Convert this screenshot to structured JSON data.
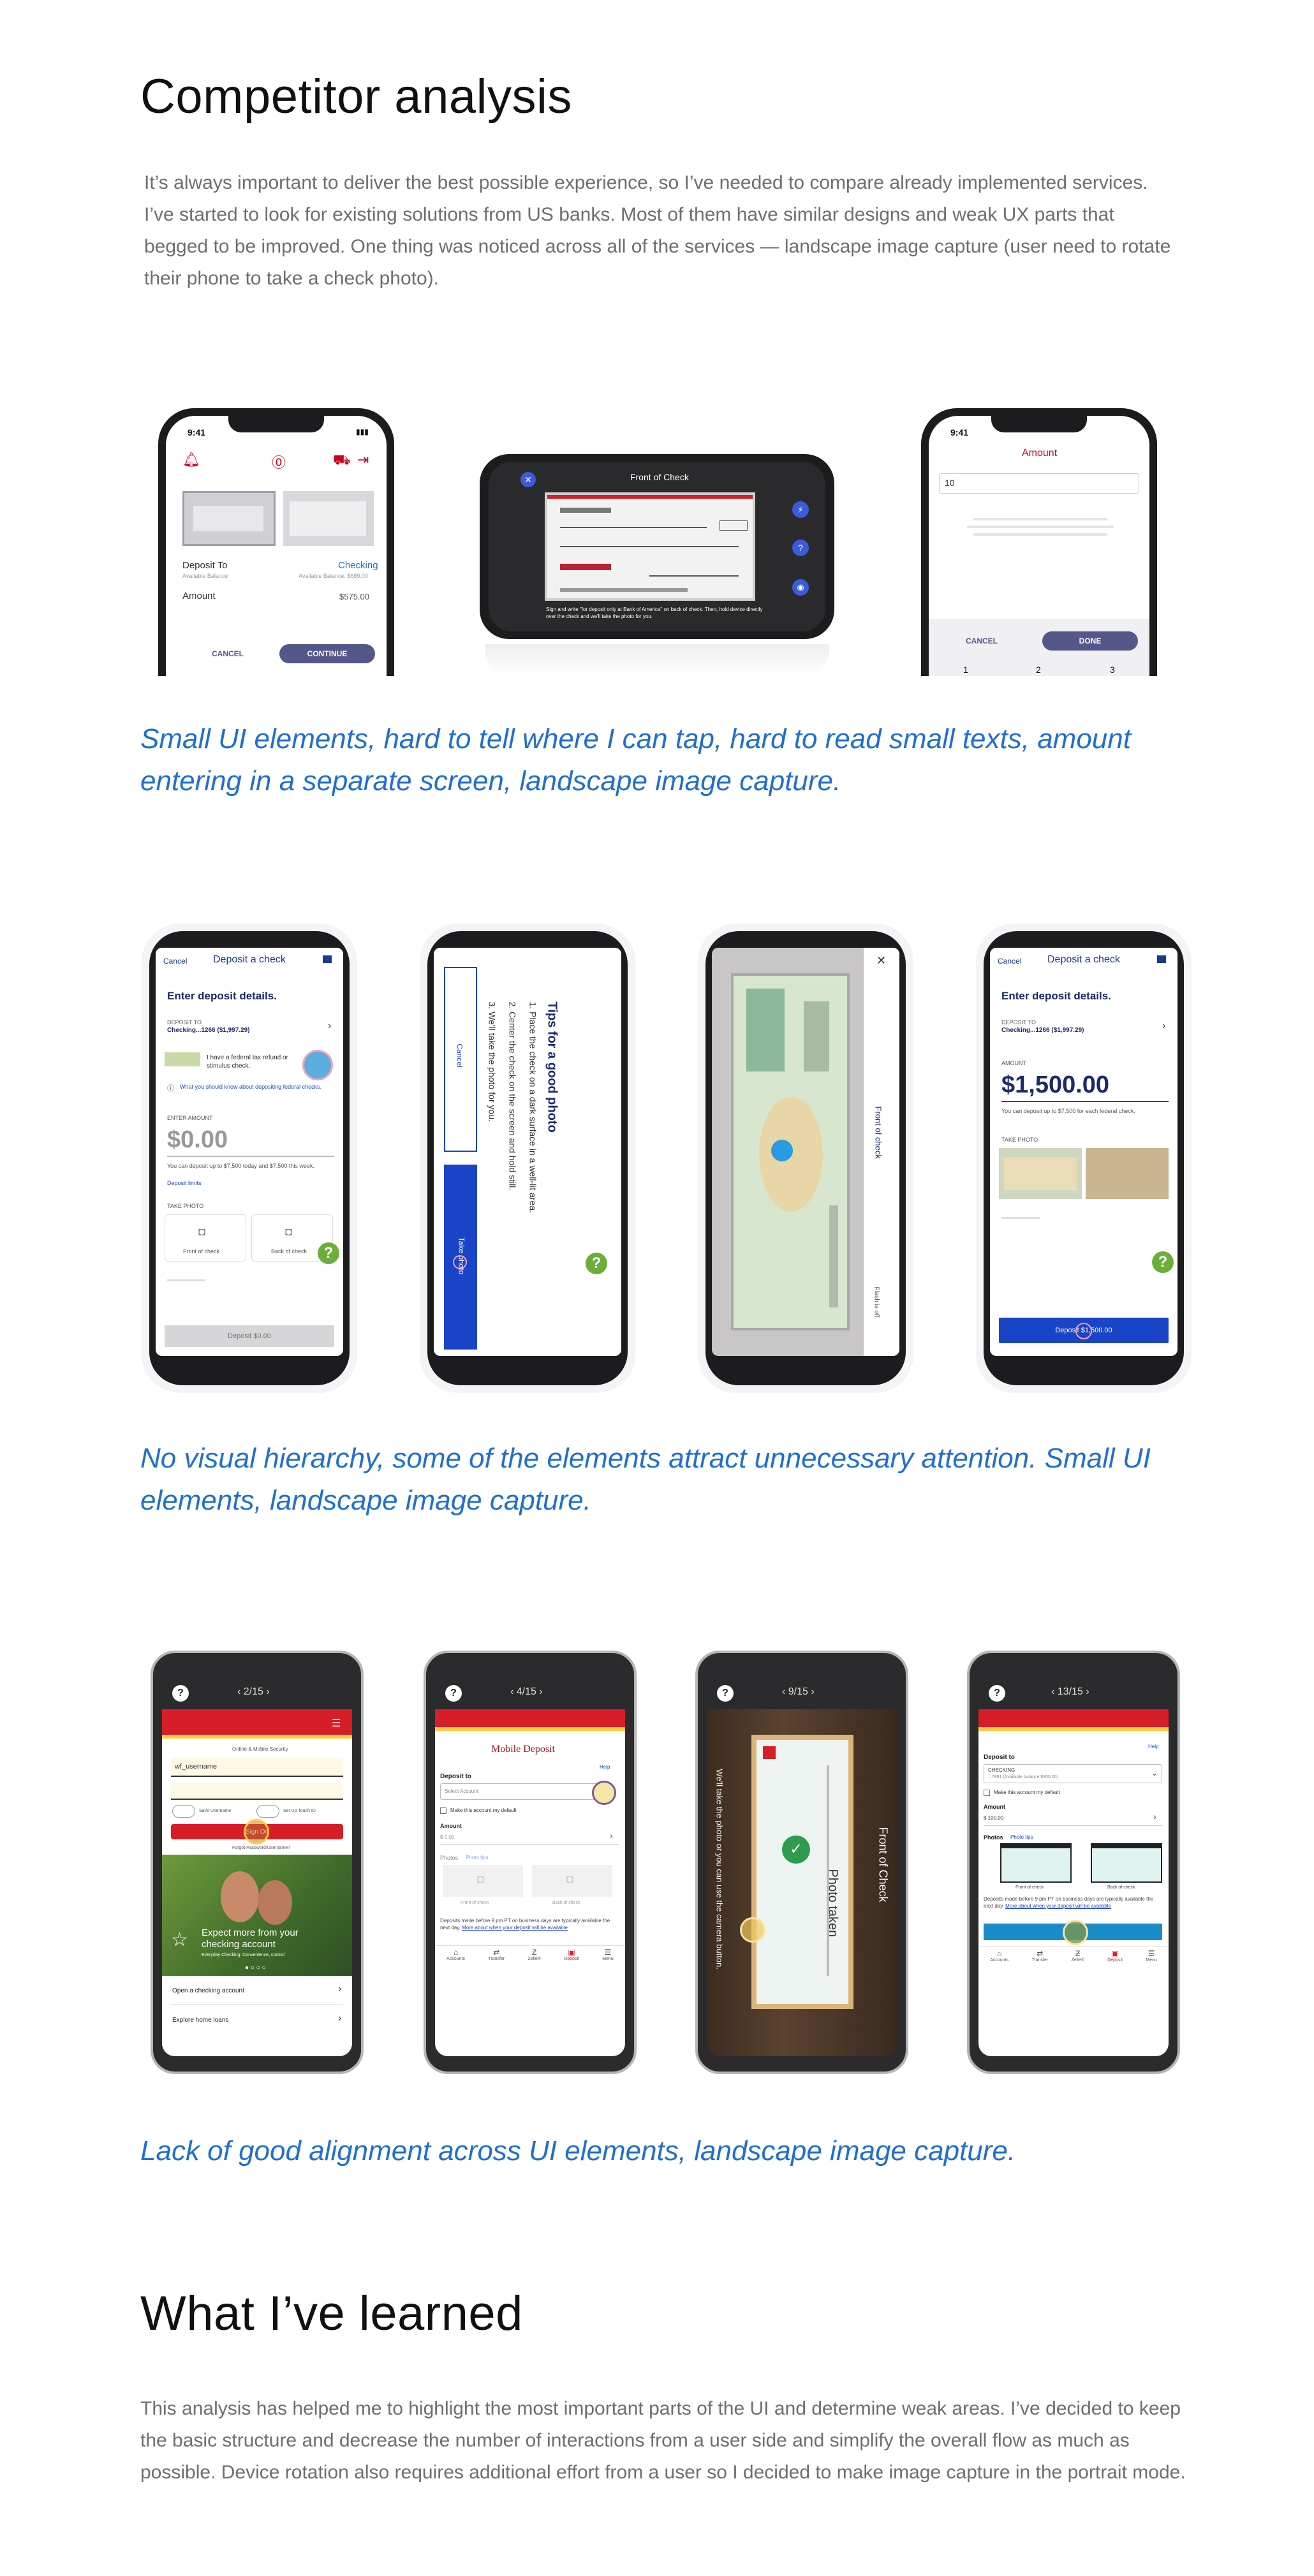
{
  "section1": {
    "title": "Competitor analysis",
    "intro": "It’s always important to deliver the best possible experience, so I’ve needed to compare already implemented services. I’ve started to look for existing solutions from US banks. Most of them have similar designs and weak UX parts that begged to be improved. One thing was noticed across all of the services — landscape image capture (user need to rotate their phone to take a check photo)."
  },
  "row1": {
    "caption": "Small UI elements, hard to tell where I can tap, hard to read small texts, amount entering in a separate screen, landscape image capture.",
    "phone1": {
      "time": "9:41",
      "deposit_to": "Deposit To",
      "available_balance": "Available Balance",
      "account": "Checking",
      "account_balance": "Available Balance: $689.00",
      "amount_label": "Amount",
      "amount_value": "$575.00",
      "cancel": "CANCEL",
      "continue": "CONTINUE"
    },
    "phone2": {
      "title": "Front of Check",
      "hint": "Sign and write \"for deposit only at Bank of America\" on back of check. Then, hold device directly over the check and we'll take the photo for you."
    },
    "phone3": {
      "time": "9:41",
      "title": "Amount",
      "value": "10",
      "cancel": "CANCEL",
      "done": "DONE",
      "keys": [
        "1",
        "2",
        "3"
      ]
    }
  },
  "row2": {
    "caption": "No visual hierarchy, some of the elements attract unnecessary attention. Small UI elements, landscape image capture.",
    "phone1": {
      "cancel": "Cancel",
      "title": "Deposit a check",
      "heading": "Enter deposit details.",
      "deposit_to": "DEPOSIT TO",
      "account": "Checking...1266 ($1,997.29)",
      "refund_text": "I have a federal tax refund or stimulus check.",
      "info_text": "What you should know about depositing federal checks.",
      "enter_amount": "ENTER AMOUNT",
      "amount": "$0.00",
      "limit_text": "You can deposit up to $7,500 today and $7,500 this week.",
      "deposit_limits": "Deposit limits",
      "take_photo": "TAKE PHOTO",
      "front": "Front of check",
      "back": "Back of check",
      "button": "Deposit $0.00"
    },
    "phone2": {
      "title": "Tips for a good photo",
      "tip1": "1. Place the check on a dark surface in a well-lit area.",
      "tip2": "2. Center the check on the screen and hold still.",
      "tip3": "3. We'll take the photo for you.",
      "cancel": "Cancel",
      "take_photo": "Take photo"
    },
    "phone3": {
      "side_label": "Front of check",
      "flash": "Flash is off"
    },
    "phone4": {
      "cancel": "Cancel",
      "title": "Deposit a check",
      "heading": "Enter deposit details.",
      "deposit_to": "DEPOSIT TO",
      "account": "Checking...1266 ($1,997.29)",
      "amount_label": "AMOUNT",
      "amount": "$1,500.00",
      "limit_text": "You can deposit up to $7,500 for each federal check.",
      "take_photo": "TAKE PHOTO",
      "button": "Deposit $1,500.00"
    }
  },
  "row3": {
    "caption": "Lack of good alignment across UI elements, landscape image capture.",
    "phone1": {
      "pager": "‹  2/15  ›",
      "security": "Online & Mobile Security",
      "username": "wf_username",
      "save_username": "Save Username",
      "touch_id": "Set Up Touch ID",
      "sign_on": "Sign On",
      "forgot": "Forgot Password/Username?",
      "promo": "Expect more from your checking account",
      "promo_sub": "Everyday Checking. Convenience, control",
      "link1": "Open a checking account",
      "link2": "Explore home loans"
    },
    "phone2": {
      "pager": "‹  4/15  ›",
      "title": "Mobile Deposit",
      "help": "Help",
      "deposit_to": "Deposit to",
      "select_account": "Select Account",
      "default_text": "Make this account my default",
      "amount_label": "Amount",
      "amount": "$ 0.00",
      "photos": "Photos",
      "photo_tips": "Photo tips",
      "front": "Front of check",
      "back": "Back of check",
      "note": "Deposits made before 9 pm PT on business days are typically available the next day.",
      "note_link": "More about when your deposit will be available",
      "nav": [
        "Accounts",
        "Transfer",
        "Zelle®",
        "Deposit",
        "Menu"
      ]
    },
    "phone3": {
      "pager": "‹  9/15  ›",
      "side_left": "We'll take the photo or you can use the camera button.",
      "side_right": "Front of Check",
      "taken": "Photo taken"
    },
    "phone4": {
      "pager": "‹  13/15  ›",
      "help": "Help",
      "deposit_to": "Deposit to",
      "account": "CHECKING",
      "account_sub": "...7891 (Available balance $300.00)",
      "default_text": "Make this account my default",
      "amount_label": "Amount",
      "amount": "$ 100.00",
      "photos": "Photos",
      "photo_tips": "Photo tips",
      "front": "Front of check",
      "back": "Back of check",
      "note": "Deposits made before 9 pm PT on business days are typically available the next day.",
      "note_link": "More about when your deposit will be available",
      "nav": [
        "Accounts",
        "Transfer",
        "Zelle®",
        "Deposit",
        "Menu"
      ]
    }
  },
  "section2": {
    "title": "What I’ve learned",
    "body": "This analysis has helped me to highlight the most important parts of the UI and determine weak areas. I’ve decided to keep the basic structure and decrease the number of interactions from a user side and simplify the overall flow as much as possible. Device rotation also requires additional effort from a user so I decided to make image capture in the portrait mode."
  },
  "colors": {
    "caption_blue": "#1f6fd1",
    "boa_navy": "#54578a",
    "chase_blue": "#1a44c8",
    "wells_red": "#d71e28",
    "wells_gold": "#ffcd41",
    "help_green": "#6cae3a"
  }
}
